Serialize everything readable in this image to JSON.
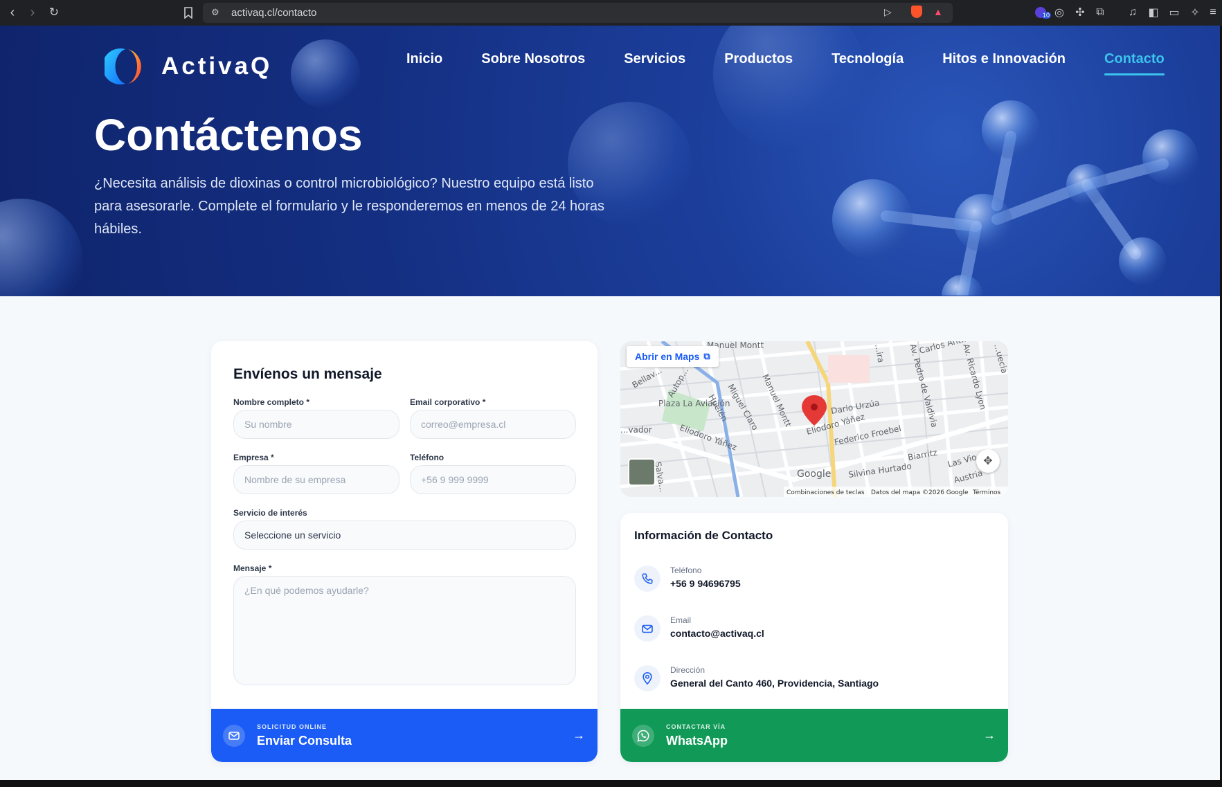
{
  "browser": {
    "url": "activaq.cl/contacto",
    "badge_count": "10"
  },
  "site": {
    "logo_text": "ActivaQ",
    "nav": [
      {
        "label": "Inicio"
      },
      {
        "label": "Sobre Nosotros"
      },
      {
        "label": "Servicios"
      },
      {
        "label": "Productos"
      },
      {
        "label": "Tecnología"
      },
      {
        "label": "Hitos e Innovación"
      },
      {
        "label": "Contacto",
        "active": true
      }
    ]
  },
  "hero": {
    "title": "Contáctenos",
    "subtitle": "¿Necesita análisis de dioxinas o control microbiológico? Nuestro equipo está listo para asesorarle. Complete el formulario y le responderemos en menos de 24 horas hábiles."
  },
  "form": {
    "title": "Envíenos un mensaje",
    "fields": {
      "name": {
        "label": "Nombre completo *",
        "placeholder": "Su nombre"
      },
      "email": {
        "label": "Email corporativo *",
        "placeholder": "correo@empresa.cl"
      },
      "company": {
        "label": "Empresa *",
        "placeholder": "Nombre de su empresa"
      },
      "phone": {
        "label": "Teléfono",
        "placeholder": "+56 9 999 9999"
      },
      "service": {
        "label": "Servicio de interés",
        "value": "Seleccione un servicio"
      },
      "message": {
        "label": "Mensaje *",
        "placeholder": "¿En qué podemos ayudarle?"
      }
    },
    "submit": {
      "small": "SOLICITUD ONLINE",
      "label": "Enviar Consulta"
    }
  },
  "map": {
    "open_label": "Abrir en Maps",
    "streets": [
      "Manuel Montt",
      "Carlos Ant...",
      "Av. Pedro de Valdivia",
      "Av. Ricardo Lyon",
      "Bellav...",
      "Autop...",
      "Plaza La Aviación",
      "Miguel Claro",
      "Manuel Montt",
      "Dario Urzúa",
      "Eliodoro Yáñez",
      "Eliodoro Yáñez",
      "Federico Froebel",
      "...vador",
      "Biarritz",
      "Las Vio...",
      "Silvina Hurtado",
      "Austria",
      "Salva...",
      "Huelén",
      "...uecia",
      "...ira"
    ],
    "footer": [
      "Combinaciones de teclas",
      "Datos del mapa ©2026 Google",
      "Términos"
    ],
    "google": "Google"
  },
  "contact": {
    "title": "Información de Contacto",
    "phone": {
      "label": "Teléfono",
      "value": "+56 9 94696795"
    },
    "email": {
      "label": "Email",
      "value": "contacto@activaq.cl"
    },
    "address": {
      "label": "Dirección",
      "value": "General del Canto 460, Providencia, Santiago"
    },
    "whatsapp": {
      "small": "CONTACTAR VÍA",
      "label": "WhatsApp"
    }
  },
  "colors": {
    "primary_blue": "#1a5cf5",
    "whatsapp_green": "#119a57",
    "nav_active": "#3cc3ee"
  }
}
